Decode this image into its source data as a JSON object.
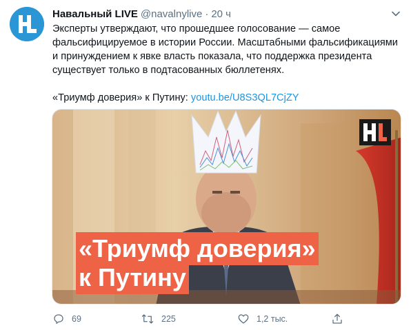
{
  "tweet": {
    "author_name": "Навальный LIVE",
    "handle": "@navalnylive",
    "separator": "·",
    "time": "20 ч",
    "avatar_letters": "HL",
    "text_main": "Эксперты утверждают, что прошедшее голосование — самое фальсифицируемое в истории России. Масштабными фальсификациями и принуждением к явке власть показала, что поддержка президента существует только в подтасованных бюллетенях.",
    "link_prefix": "«Триумф доверия» к Путину: ",
    "link_text": "youtu.be/U8S3QL7CjZY"
  },
  "media": {
    "overlay_line1": "«Триумф доверия»",
    "overlay_line2": "к Путину",
    "logo_letters": "HL"
  },
  "actions": {
    "reply_count": "69",
    "retweet_count": "225",
    "like_count": "1,2 тыс.",
    "share_count": ""
  },
  "colors": {
    "accent": "#1b95e0",
    "secondary_text": "#5b7083",
    "overlay_bg": "#ee6246",
    "avatar_bg": "#2a96d6"
  },
  "icons": [
    "reply-icon",
    "retweet-icon",
    "like-icon",
    "share-icon",
    "chevron-down-icon"
  ]
}
